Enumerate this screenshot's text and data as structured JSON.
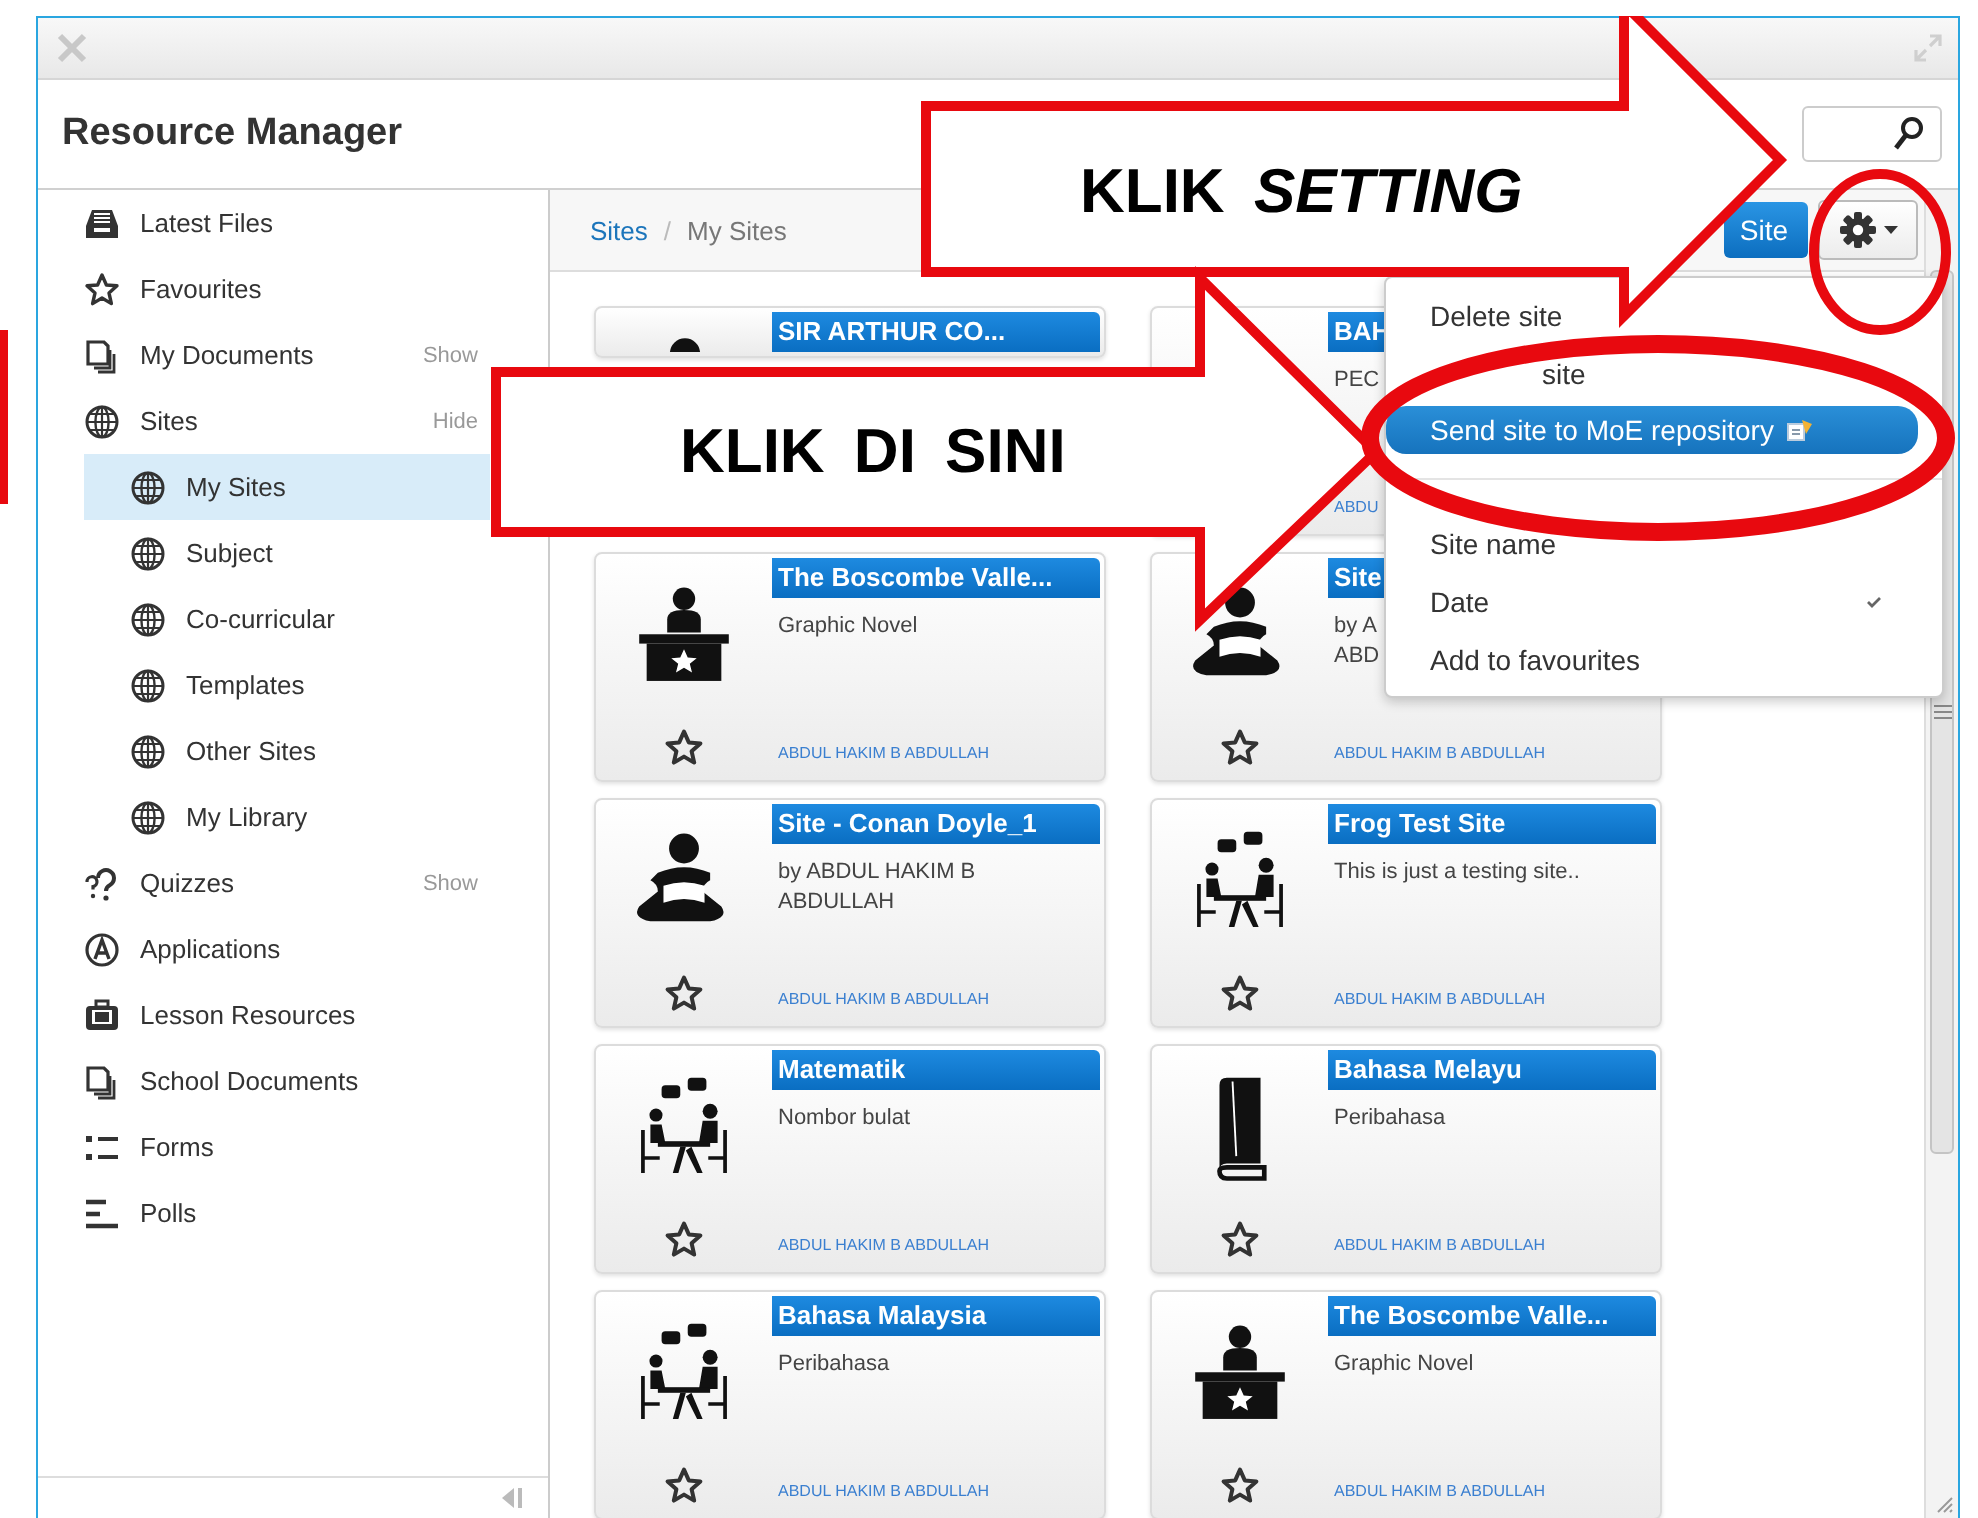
{
  "window": {
    "title": "Resource Manager"
  },
  "sidebar": {
    "items": [
      {
        "label": "Latest Files",
        "selected": false
      },
      {
        "label": "Favourites",
        "selected": false
      },
      {
        "label": "My Documents",
        "selected": false,
        "toggle": "Show"
      },
      {
        "label": "Sites",
        "selected": false,
        "toggle": "Hide",
        "expanded": true,
        "children": [
          {
            "label": "My Sites",
            "selected": true
          },
          {
            "label": "Subject",
            "selected": false
          },
          {
            "label": "Co-curricular",
            "selected": false
          },
          {
            "label": "Templates",
            "selected": false
          },
          {
            "label": "Other Sites",
            "selected": false
          },
          {
            "label": "My Library",
            "selected": false
          }
        ]
      },
      {
        "label": "Quizzes",
        "selected": false,
        "toggle": "Show"
      },
      {
        "label": "Applications",
        "selected": false
      },
      {
        "label": "Lesson Resources",
        "selected": false
      },
      {
        "label": "School Documents",
        "selected": false
      },
      {
        "label": "Forms",
        "selected": false
      },
      {
        "label": "Polls",
        "selected": false
      }
    ]
  },
  "breadcrumb": {
    "items": [
      "Sites",
      "My Sites"
    ],
    "separator": "/"
  },
  "toolbar": {
    "button": "Site"
  },
  "menu": {
    "items": [
      {
        "kind": "action",
        "label": "Delete site",
        "selected": false
      },
      {
        "kind": "action",
        "label": "site",
        "selected": false
      },
      {
        "kind": "action",
        "label": "Send site to MoE repository",
        "selected": true
      },
      {
        "kind": "sort",
        "label": "Site name",
        "selected": false,
        "checked": false
      },
      {
        "kind": "sort",
        "label": "Date",
        "selected": false,
        "checked": true
      },
      {
        "kind": "action",
        "label": "Add to favourites",
        "selected": false
      }
    ]
  },
  "cards": [
    {
      "title": "SIR ARTHUR CO..."
    },
    {
      "title": "BAH",
      "description": "PEC",
      "author": "ABDU"
    },
    {
      "title": "The Boscombe Valle...",
      "description": "Graphic Novel",
      "author": "ABDUL HAKIM B ABDULLAH",
      "favourite": false
    },
    {
      "title": "Site",
      "description": "by A\nABD",
      "author": "ABDUL HAKIM B ABDULLAH",
      "favourite": false
    },
    {
      "title": "Site - Conan Doyle_1",
      "description": "by ABDUL HAKIM B ABDULLAH",
      "author": "ABDUL HAKIM B ABDULLAH",
      "favourite": false
    },
    {
      "title": "Frog Test Site",
      "description": "This is just a testing site..",
      "author": "ABDUL HAKIM B ABDULLAH",
      "favourite": false
    },
    {
      "title": "Matematik",
      "description": "Nombor bulat",
      "author": "ABDUL HAKIM B ABDULLAH",
      "favourite": false
    },
    {
      "title": "Bahasa Melayu",
      "description": "Peribahasa",
      "author": "ABDUL HAKIM B ABDULLAH",
      "favourite": false
    },
    {
      "title": "Bahasa Malaysia",
      "description": "Peribahasa",
      "author": "ABDUL HAKIM B ABDULLAH",
      "favourite": false
    },
    {
      "title": "The Boscombe Valle...",
      "description": "Graphic Novel",
      "author": "ABDUL HAKIM B ABDULLAH",
      "favourite": false
    }
  ],
  "callouts": [
    {
      "text": "KLIK *SETTING*"
    },
    {
      "text": "KLIK DI SINI"
    }
  ]
}
